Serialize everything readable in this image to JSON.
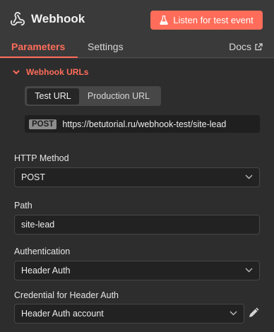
{
  "header": {
    "title": "Webhook",
    "title_icon": "webhook-icon",
    "listen_button": "Listen for test event",
    "listen_icon": "flask-icon"
  },
  "tabs": {
    "parameters": "Parameters",
    "settings": "Settings",
    "docs": "Docs",
    "docs_icon": "external-link-icon"
  },
  "webhook_urls": {
    "section_label": "Webhook URLs",
    "toggle": {
      "test": "Test URL",
      "production": "Production URL",
      "selected": "Test URL"
    },
    "method": "POST",
    "url": "https://betutorial.ru/webhook-test/site-lead"
  },
  "fields": {
    "http_method": {
      "label": "HTTP Method",
      "value": "POST"
    },
    "path": {
      "label": "Path",
      "value": "site-lead"
    },
    "authentication": {
      "label": "Authentication",
      "value": "Header Auth"
    },
    "credential": {
      "label": "Credential for Header Auth",
      "value": "Header Auth account",
      "edit_icon": "pencil-icon"
    }
  },
  "colors": {
    "accent": "#ff6d5a",
    "panel": "#3a3a3a",
    "content": "#2d2d2d"
  }
}
